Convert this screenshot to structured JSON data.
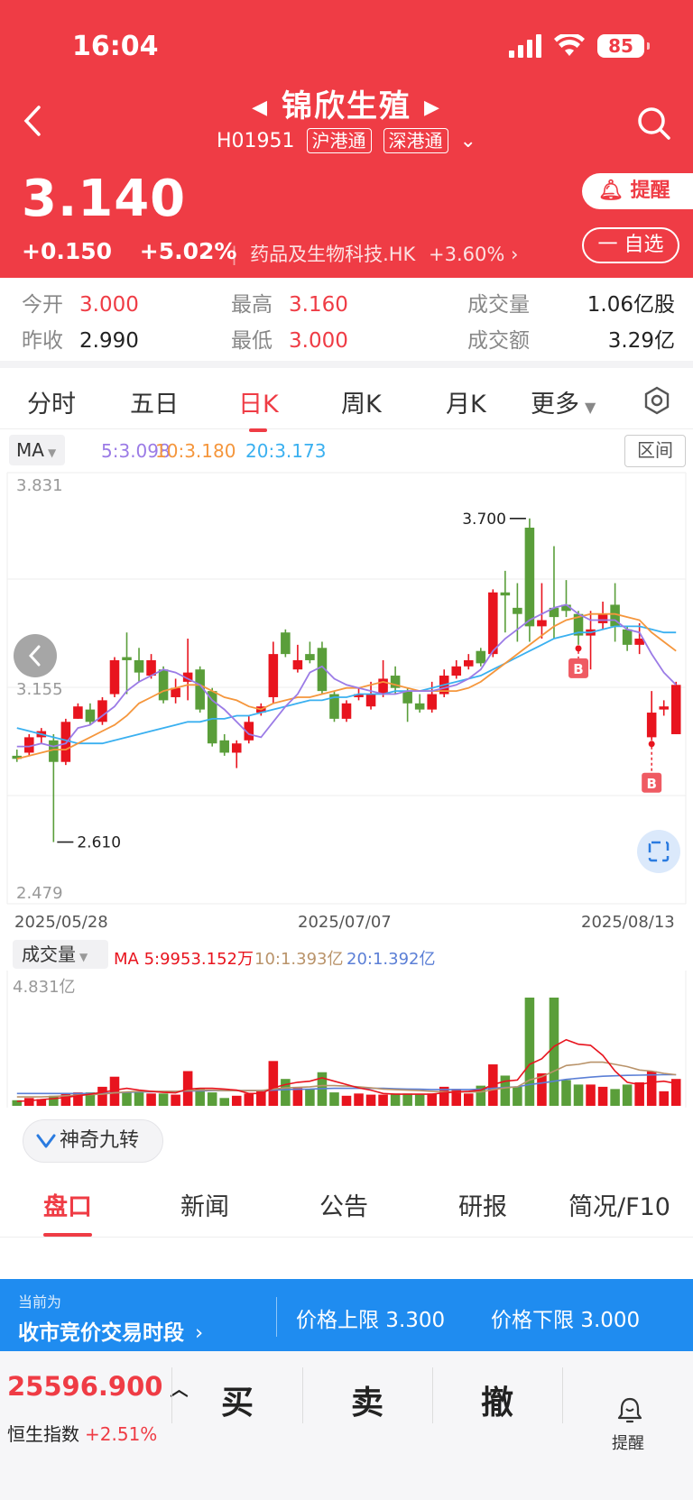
{
  "status": {
    "time": "16:04",
    "battery": "85"
  },
  "header": {
    "title": "锦欣生殖",
    "code": "H01951",
    "tags": [
      "沪港通",
      "深港通"
    ],
    "price": "3.140",
    "change": "+0.150",
    "change_pct": "+5.02%",
    "sector": "药品及生物科技.HK",
    "sector_change": "+3.60%",
    "remind_label": "提醒",
    "watch_label": "一 自选"
  },
  "stats": {
    "open_label": "今开",
    "open": "3.000",
    "prev_label": "昨收",
    "prev": "2.990",
    "high_label": "最高",
    "high": "3.160",
    "low_label": "最低",
    "low": "3.000",
    "vol_label": "成交量",
    "vol": "1.06亿股",
    "amt_label": "成交额",
    "amt": "3.29亿"
  },
  "tabs": [
    "分时",
    "五日",
    "日K",
    "周K",
    "月K",
    "更多"
  ],
  "active_tab": "日K",
  "ma": {
    "label": "MA",
    "ma5": "5:3.098",
    "ma10": "10:3.180",
    "ma20": "20:3.173",
    "range_label": "区间"
  },
  "colors": {
    "up": "#e8141e",
    "down": "#5a9e3a",
    "ma5": "#9b7be6",
    "ma10": "#f5963c",
    "ma20": "#3ab0f0",
    "accent": "#ef3c45"
  },
  "chart_data": {
    "type": "candlestick",
    "y_axis_labels": [
      "3.831",
      "3.155",
      "2.479"
    ],
    "ylim": [
      2.479,
      3.831
    ],
    "x_axis_labels": [
      "2025/05/28",
      "2025/07/07",
      "2025/08/13"
    ],
    "high_annotation": "3.700",
    "low_annotation": "2.610",
    "marker_label": "B",
    "candles": [
      {
        "o": 2.93,
        "c": 2.92,
        "h": 2.95,
        "l": 2.91
      },
      {
        "o": 2.94,
        "c": 2.99,
        "h": 3.0,
        "l": 2.93
      },
      {
        "o": 2.99,
        "c": 3.01,
        "h": 3.02,
        "l": 2.97
      },
      {
        "o": 2.98,
        "c": 2.91,
        "h": 3.0,
        "l": 2.65
      },
      {
        "o": 2.91,
        "c": 3.04,
        "h": 3.05,
        "l": 2.9
      },
      {
        "o": 3.05,
        "c": 3.09,
        "h": 3.1,
        "l": 3.05
      },
      {
        "o": 3.08,
        "c": 3.04,
        "h": 3.1,
        "l": 3.03
      },
      {
        "o": 3.04,
        "c": 3.11,
        "h": 3.12,
        "l": 3.03
      },
      {
        "o": 3.13,
        "c": 3.24,
        "h": 3.25,
        "l": 3.12
      },
      {
        "o": 3.25,
        "c": 3.24,
        "h": 3.33,
        "l": 3.13
      },
      {
        "o": 3.24,
        "c": 3.2,
        "h": 3.28,
        "l": 3.17
      },
      {
        "o": 3.19,
        "c": 3.24,
        "h": 3.26,
        "l": 3.18
      },
      {
        "o": 3.21,
        "c": 3.11,
        "h": 3.22,
        "l": 3.1
      },
      {
        "o": 3.12,
        "c": 3.15,
        "h": 3.18,
        "l": 3.1
      },
      {
        "o": 3.17,
        "c": 3.2,
        "h": 3.31,
        "l": 3.11
      },
      {
        "o": 3.21,
        "c": 3.08,
        "h": 3.22,
        "l": 3.07
      },
      {
        "o": 3.14,
        "c": 2.97,
        "h": 3.15,
        "l": 2.96
      },
      {
        "o": 2.98,
        "c": 2.94,
        "h": 3.0,
        "l": 2.93
      },
      {
        "o": 2.94,
        "c": 2.97,
        "h": 2.98,
        "l": 2.89
      },
      {
        "o": 2.98,
        "c": 3.04,
        "h": 3.06,
        "l": 2.97
      },
      {
        "o": 3.07,
        "c": 3.09,
        "h": 3.1,
        "l": 3.06
      },
      {
        "o": 3.12,
        "c": 3.26,
        "h": 3.3,
        "l": 3.1
      },
      {
        "o": 3.33,
        "c": 3.26,
        "h": 3.34,
        "l": 3.25
      },
      {
        "o": 3.21,
        "c": 3.24,
        "h": 3.29,
        "l": 3.2
      },
      {
        "o": 3.26,
        "c": 3.24,
        "h": 3.3,
        "l": 3.23
      },
      {
        "o": 3.28,
        "c": 3.14,
        "h": 3.3,
        "l": 3.13
      },
      {
        "o": 3.13,
        "c": 3.05,
        "h": 3.14,
        "l": 3.04
      },
      {
        "o": 3.05,
        "c": 3.1,
        "h": 3.11,
        "l": 3.04
      },
      {
        "o": 3.12,
        "c": 3.13,
        "h": 3.15,
        "l": 3.11
      },
      {
        "o": 3.09,
        "c": 3.13,
        "h": 3.17,
        "l": 3.08
      },
      {
        "o": 3.13,
        "c": 3.18,
        "h": 3.24,
        "l": 3.12
      },
      {
        "o": 3.19,
        "c": 3.15,
        "h": 3.22,
        "l": 3.13
      },
      {
        "o": 3.14,
        "c": 3.1,
        "h": 3.15,
        "l": 3.04
      },
      {
        "o": 3.1,
        "c": 3.08,
        "h": 3.13,
        "l": 3.07
      },
      {
        "o": 3.08,
        "c": 3.13,
        "h": 3.17,
        "l": 3.07
      },
      {
        "o": 3.13,
        "c": 3.19,
        "h": 3.21,
        "l": 3.12
      },
      {
        "o": 3.19,
        "c": 3.22,
        "h": 3.24,
        "l": 3.18
      },
      {
        "o": 3.22,
        "c": 3.24,
        "h": 3.26,
        "l": 3.21
      },
      {
        "o": 3.27,
        "c": 3.23,
        "h": 3.28,
        "l": 3.22
      },
      {
        "o": 3.26,
        "c": 3.46,
        "h": 3.47,
        "l": 3.25
      },
      {
        "o": 3.46,
        "c": 3.45,
        "h": 3.53,
        "l": 3.33
      },
      {
        "o": 3.41,
        "c": 3.39,
        "h": 3.49,
        "l": 3.3
      },
      {
        "o": 3.67,
        "c": 3.35,
        "h": 3.7,
        "l": 3.3
      },
      {
        "o": 3.35,
        "c": 3.37,
        "h": 3.49,
        "l": 3.31
      },
      {
        "o": 3.41,
        "c": 3.38,
        "h": 3.61,
        "l": 3.31
      },
      {
        "o": 3.42,
        "c": 3.4,
        "h": 3.5,
        "l": 3.38
      },
      {
        "o": 3.39,
        "c": 3.32,
        "h": 3.4,
        "l": 3.29
      },
      {
        "o": 3.32,
        "c": 3.34,
        "h": 3.4,
        "l": 3.21
      },
      {
        "o": 3.36,
        "c": 3.39,
        "h": 3.43,
        "l": 3.34
      },
      {
        "o": 3.42,
        "c": 3.35,
        "h": 3.49,
        "l": 3.3
      },
      {
        "o": 3.34,
        "c": 3.29,
        "h": 3.35,
        "l": 3.27
      },
      {
        "o": 3.29,
        "c": 3.31,
        "h": 3.36,
        "l": 3.26
      },
      {
        "o": 2.99,
        "c": 3.07,
        "h": 3.14,
        "l": 2.98
      },
      {
        "o": 3.08,
        "c": 3.09,
        "h": 3.11,
        "l": 3.06
      },
      {
        "o": 3.0,
        "c": 3.16,
        "h": 3.17,
        "l": 3.0
      }
    ],
    "ma5": [
      2.96,
      2.96,
      2.97,
      2.96,
      2.97,
      3.02,
      3.03,
      3.06,
      3.09,
      3.14,
      3.17,
      3.19,
      3.21,
      3.2,
      3.18,
      3.16,
      3.11,
      3.08,
      3.04,
      3.0,
      2.99,
      3.04,
      3.09,
      3.13,
      3.2,
      3.22,
      3.18,
      3.16,
      3.15,
      3.14,
      3.13,
      3.13,
      3.14,
      3.14,
      3.14,
      3.15,
      3.16,
      3.18,
      3.21,
      3.27,
      3.31,
      3.34,
      3.37,
      3.39,
      3.41,
      3.42,
      3.39,
      3.37,
      3.37,
      3.37,
      3.34,
      3.33,
      3.26,
      3.2,
      3.16
    ],
    "ma10": [
      2.92,
      2.93,
      2.94,
      2.95,
      2.95,
      2.97,
      2.99,
      3.01,
      3.03,
      3.06,
      3.1,
      3.12,
      3.14,
      3.15,
      3.16,
      3.16,
      3.14,
      3.12,
      3.11,
      3.09,
      3.08,
      3.1,
      3.11,
      3.12,
      3.12,
      3.13,
      3.14,
      3.15,
      3.15,
      3.16,
      3.17,
      3.16,
      3.15,
      3.14,
      3.14,
      3.14,
      3.14,
      3.15,
      3.17,
      3.2,
      3.23,
      3.26,
      3.29,
      3.32,
      3.35,
      3.37,
      3.38,
      3.39,
      3.39,
      3.39,
      3.38,
      3.37,
      3.33,
      3.3,
      3.27
    ],
    "ma20": [
      3.02,
      3.01,
      3.0,
      2.99,
      2.98,
      2.97,
      2.97,
      2.97,
      2.98,
      2.99,
      3.0,
      3.01,
      3.02,
      3.03,
      3.04,
      3.04,
      3.05,
      3.05,
      3.06,
      3.06,
      3.07,
      3.08,
      3.09,
      3.1,
      3.11,
      3.11,
      3.12,
      3.12,
      3.13,
      3.13,
      3.13,
      3.14,
      3.14,
      3.14,
      3.15,
      3.16,
      3.17,
      3.18,
      3.19,
      3.21,
      3.23,
      3.25,
      3.27,
      3.29,
      3.31,
      3.32,
      3.33,
      3.33,
      3.34,
      3.35,
      3.35,
      3.35,
      3.34,
      3.33,
      3.33
    ],
    "volume": {
      "label": "成交量",
      "ma5_label": "MA 5:9953.152万",
      "ma10_label": "10:1.393亿",
      "ma20_label": "20:1.392亿",
      "y_axis_label": "4.831亿",
      "ylim": [
        0,
        4.831
      ],
      "values": [
        0.25,
        0.35,
        0.3,
        0.45,
        0.55,
        0.6,
        0.6,
        0.85,
        1.3,
        0.6,
        0.6,
        0.55,
        0.55,
        0.5,
        1.55,
        0.75,
        0.6,
        0.35,
        0.45,
        0.55,
        0.65,
        2.0,
        1.2,
        0.8,
        0.75,
        1.5,
        0.6,
        0.45,
        0.55,
        0.5,
        0.5,
        0.55,
        0.55,
        0.5,
        0.55,
        0.85,
        0.75,
        0.55,
        0.9,
        1.85,
        1.35,
        0.85,
        4.9,
        1.45,
        4.9,
        1.15,
        0.95,
        0.95,
        0.85,
        0.75,
        0.95,
        1.05,
        1.55,
        0.65,
        1.2
      ],
      "ma5": [
        0.2,
        0.22,
        0.28,
        0.32,
        0.38,
        0.45,
        0.52,
        0.6,
        0.7,
        0.78,
        0.7,
        0.65,
        0.6,
        0.58,
        0.75,
        0.78,
        0.78,
        0.75,
        0.7,
        0.55,
        0.55,
        0.8,
        0.95,
        1.05,
        1.1,
        1.25,
        1.1,
        0.95,
        0.8,
        0.7,
        0.55,
        0.52,
        0.52,
        0.52,
        0.52,
        0.58,
        0.62,
        0.65,
        0.7,
        0.95,
        1.1,
        1.15,
        1.85,
        2.1,
        2.65,
        2.95,
        2.75,
        2.7,
        2.25,
        1.55,
        1.05,
        0.95,
        1.05,
        1.1,
        1.0
      ],
      "ma10": [
        0.4,
        0.4,
        0.4,
        0.42,
        0.45,
        0.48,
        0.5,
        0.52,
        0.58,
        0.62,
        0.65,
        0.65,
        0.65,
        0.65,
        0.68,
        0.7,
        0.7,
        0.68,
        0.68,
        0.68,
        0.68,
        0.75,
        0.8,
        0.82,
        0.85,
        0.9,
        0.9,
        0.88,
        0.85,
        0.8,
        0.75,
        0.72,
        0.7,
        0.68,
        0.65,
        0.62,
        0.62,
        0.62,
        0.62,
        0.72,
        0.8,
        0.85,
        1.15,
        1.3,
        1.55,
        1.8,
        1.85,
        1.95,
        1.95,
        1.85,
        1.75,
        1.6,
        1.55,
        1.45,
        1.39
      ],
      "ma20": [
        0.55,
        0.55,
        0.55,
        0.55,
        0.55,
        0.55,
        0.55,
        0.56,
        0.58,
        0.6,
        0.62,
        0.63,
        0.64,
        0.65,
        0.66,
        0.67,
        0.68,
        0.68,
        0.68,
        0.68,
        0.68,
        0.7,
        0.72,
        0.74,
        0.75,
        0.77,
        0.78,
        0.78,
        0.78,
        0.78,
        0.78,
        0.76,
        0.75,
        0.74,
        0.73,
        0.73,
        0.73,
        0.73,
        0.74,
        0.78,
        0.82,
        0.85,
        0.95,
        1.02,
        1.1,
        1.18,
        1.23,
        1.28,
        1.32,
        1.34,
        1.36,
        1.37,
        1.38,
        1.39,
        1.39
      ]
    }
  },
  "magic_label": "神奇九转",
  "bottom_tabs": [
    "盘口",
    "新闻",
    "公告",
    "研报",
    "简况/F10"
  ],
  "auction": {
    "small": "当前为",
    "big": "收市竞价交易时段",
    "upper": "价格上限 3.300",
    "lower": "价格下限 3.000"
  },
  "footer": {
    "index_value": "25596.900",
    "index_name": "恒生指数",
    "index_change": "+2.51%",
    "buy": "买",
    "sell": "卖",
    "cancel": "撤",
    "remind": "提醒"
  }
}
